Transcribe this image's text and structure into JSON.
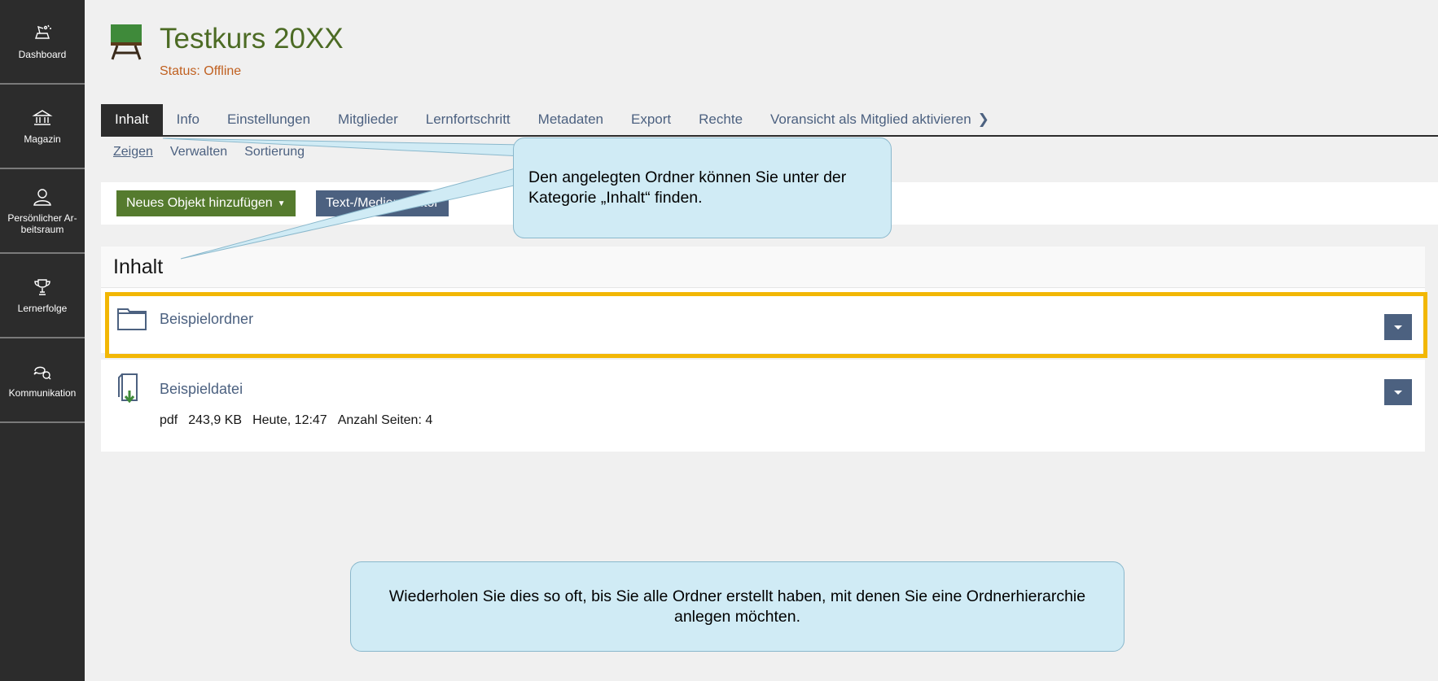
{
  "sidebar": {
    "items": [
      {
        "label": "Dashboard",
        "icon": "dashboard-icon"
      },
      {
        "label": "Magazin",
        "icon": "library-icon"
      },
      {
        "label": "Persönlicher Ar-beitsraum",
        "icon": "user-icon"
      },
      {
        "label": "Lernerfolge",
        "icon": "trophy-icon"
      },
      {
        "label": "Kommunikation",
        "icon": "chat-icon"
      }
    ]
  },
  "header": {
    "title": "Testkurs 20XX",
    "status": "Status: Offline"
  },
  "tabs": [
    {
      "label": "Inhalt",
      "active": true
    },
    {
      "label": "Info"
    },
    {
      "label": "Einstellungen"
    },
    {
      "label": "Mitglieder"
    },
    {
      "label": "Lernfortschritt"
    },
    {
      "label": "Metadaten"
    },
    {
      "label": "Export"
    },
    {
      "label": "Rechte"
    },
    {
      "label": "Voransicht als Mitglied aktivieren"
    }
  ],
  "subtabs": [
    {
      "label": "Zeigen",
      "active": true
    },
    {
      "label": "Verwalten"
    },
    {
      "label": "Sortierung"
    }
  ],
  "toolbar": {
    "add_label": "Neues Objekt hinzufügen",
    "editor_label": "Text-/Medien-Editor"
  },
  "content": {
    "heading": "Inhalt",
    "items": [
      {
        "title": "Beispielordner",
        "icon": "folder-icon"
      },
      {
        "title": "Beispieldatei",
        "icon": "file-download-icon",
        "props": {
          "type": "pdf",
          "size": "243,9 KB",
          "date": "Heute, 12:47",
          "pages": "Anzahl Seiten: 4"
        }
      }
    ]
  },
  "callouts": {
    "first": "Den angelegten Ordner können Sie unter der Kategorie „Inhalt“ finden.",
    "second": "Wiederholen Sie dies so oft, bis Sie alle Ordner erstellt haben, mit denen Sie eine Ordnerhierarchie anlegen möchten."
  },
  "colors": {
    "sidebar_bg": "#2c2c2c",
    "title_green": "#4c6b24",
    "status_orange": "#c06020",
    "link_blue": "#4c6180",
    "primary_button": "#557b2e",
    "highlight": "#f2b705",
    "callout_bg": "#d0ebf5"
  }
}
